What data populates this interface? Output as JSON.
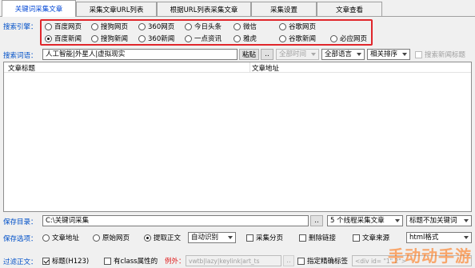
{
  "tabs": [
    {
      "label": "关键词采集文章",
      "active": true
    },
    {
      "label": "采集文章URL列表",
      "active": false
    },
    {
      "label": "根据URL列表采集文章",
      "active": false
    },
    {
      "label": "采集设置",
      "active": false
    },
    {
      "label": "文章查看",
      "active": false
    }
  ],
  "search_engine": {
    "label": "搜索引擎：",
    "row1": [
      {
        "label": "百度网页",
        "checked": false
      },
      {
        "label": "搜狗网页",
        "checked": false
      },
      {
        "label": "360网页",
        "checked": false
      },
      {
        "label": "今日头条",
        "checked": false
      },
      {
        "label": "微信",
        "checked": false
      },
      {
        "label": "谷歌网页",
        "checked": false
      }
    ],
    "row2": [
      {
        "label": "百度新闻",
        "checked": true
      },
      {
        "label": "搜狗新闻",
        "checked": false
      },
      {
        "label": "360新闻",
        "checked": false
      },
      {
        "label": "一点资讯",
        "checked": false
      },
      {
        "label": "雅虎",
        "checked": false
      },
      {
        "label": "谷歌新闻",
        "checked": false
      },
      {
        "label": "必应网页",
        "checked": false
      }
    ]
  },
  "keywords": {
    "label": "搜索词语：",
    "value": "人工智能|外星人|虚拟现实",
    "paste_button": "粘贴",
    "more_button": "..",
    "time_select": "全部时间",
    "language_select": "全部语言",
    "sort_select": "相关排序",
    "search_new_only": {
      "label": "搜索新闻标题",
      "checked": false
    }
  },
  "results_table": {
    "columns": [
      "文章标题",
      "文章地址"
    ]
  },
  "save_dir": {
    "label": "保存目录：",
    "value": "C:\\关键词采集",
    "browse_button": "..",
    "threads_select": "5 个线程采集文章",
    "title_mode_select": "标题不加关键词"
  },
  "save_options": {
    "label": "保存选项：",
    "options": [
      {
        "label": "文章地址",
        "checked": false
      },
      {
        "label": "原始网页",
        "checked": false
      },
      {
        "label": "提取正文",
        "checked": true
      }
    ],
    "recognize_select": "自动识别",
    "checks": [
      {
        "label": "采集分页",
        "checked": false
      },
      {
        "label": "删除链接",
        "checked": false
      },
      {
        "label": "文章来源",
        "checked": false
      }
    ],
    "format_select": "html格式"
  },
  "filter": {
    "label": "过滤正文：",
    "title_tag": {
      "label": "标题(H123)",
      "checked": true
    },
    "class_attr": {
      "label": "有class属性的",
      "checked": false
    },
    "exception_label": "例外：",
    "exception_value": "vwtb|lazy|keylink|art_ts",
    "exception_more": "..",
    "precise_tag": {
      "label": "指定精确标签",
      "checked": false
    },
    "tag_value": "<div id= \"1\" 2\">"
  },
  "watermark": "手动动手游",
  "colors": {
    "accent_blue": "#0050c8",
    "highlight_red": "#e0262b"
  }
}
